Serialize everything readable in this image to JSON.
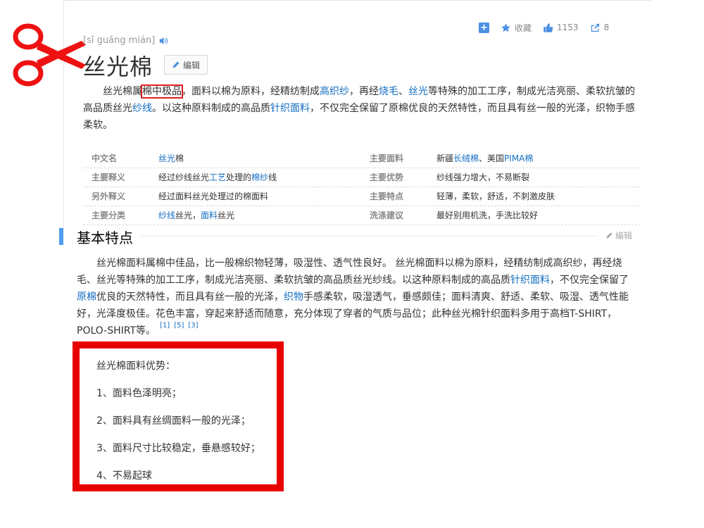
{
  "actions": {
    "collect_label": "收藏",
    "like_count": "1153",
    "share_count": "8"
  },
  "entry": {
    "pinyin": "[sī guāng mián]",
    "title": "丝光棉",
    "edit_label": "编辑"
  },
  "summary": {
    "part1": "丝光棉属",
    "highlight": "棉中极品",
    "part2": "，面料以棉为原料，经精纺制成",
    "link1": "高织纱",
    "part3": "，再经",
    "link2": "烧毛",
    "part4": "、",
    "link3": "丝光",
    "part5": "等特殊的加工工序，制成光洁亮丽、柔软抗皱的高品质丝光",
    "link4": "纱线",
    "part6": "。以这种原料制成的高品质",
    "link5": "针织面料",
    "part7": "，不仅完全保留了原棉优良的天然特性，而且具有丝一般的光泽，织物手感柔软。"
  },
  "info": {
    "rows": [
      {
        "k1": "中文名",
        "v1_link": "丝光",
        "v1_text": "棉",
        "k2": "主要面料",
        "v2_a": "新疆",
        "v2_link": "长绒棉",
        "v2_b": "、美国",
        "v2_link2": "PIMA棉"
      },
      {
        "k1": "主要释义",
        "v1_a": "经过纱线丝光",
        "v1_link": "工艺",
        "v1_b": "处理的",
        "v1_link2": "棉纱",
        "v1_c": "线",
        "k2": "主要优势",
        "v2": "纱线强力增大，不易断裂"
      },
      {
        "k1": "另外释义",
        "v1": "经过面料丝光处理过的棉面料",
        "k2": "主要特点",
        "v2": "轻薄，柔软，舒适，不刺激皮肤"
      },
      {
        "k1": "主要分类",
        "v1_link": "纱线",
        "v1_a": "丝光，",
        "v1_link2": "面料",
        "v1_b": "丝光",
        "k2": "洗涤建议",
        "v2": "最好别用机洗，手洗比较好"
      }
    ]
  },
  "section": {
    "title": "基本特点",
    "edit_label": "编辑"
  },
  "body": {
    "t1": "丝光棉面料属棉中佳品，比一般棉织物轻薄，吸湿性、透气性良好。 丝光棉面料以棉为原料，经精纺制成高织纱，再经烧毛、丝光等特殊的加工工序，制成光洁亮丽、柔软抗皱的高品质丝光纱线。以这种原料制成的高品质",
    "l1": "针织面料",
    "t2": "，不仅完全保留了",
    "l2": "原棉",
    "t3": "优良的天然特性，而且具有丝一般的光泽，",
    "l3": "织物",
    "t4": "手感柔软，吸湿透气，垂感颇佳；面料清爽、舒适、柔软、吸湿、透气性能好，光泽度极佳。花色丰富，穿起来舒适而随意，充分体现了穿者的气质与品位；此种丝光棉针织面料多用于高档T-SHIRT，POLO-SHIRT等。",
    "refs": [
      "[1]",
      "[5]",
      "[3]"
    ]
  },
  "advantages": {
    "heading": "丝光棉面料优势：",
    "items": [
      "1、面料色泽明亮；",
      "2、面料具有丝绸面料一般的光泽；",
      "3、面料尺寸比较稳定，垂悬感较好；",
      "4、不易起球"
    ]
  }
}
